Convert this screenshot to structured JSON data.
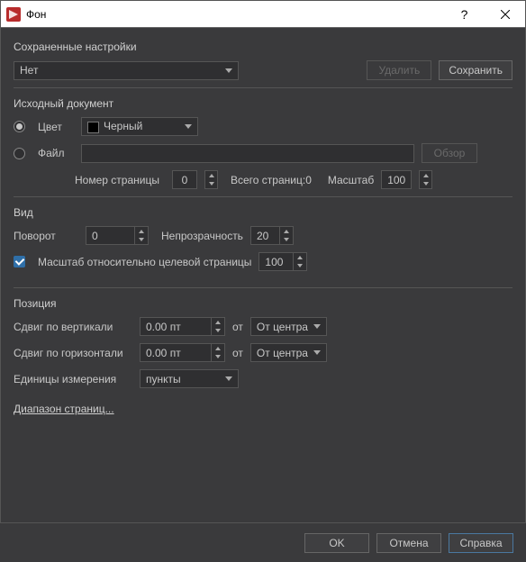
{
  "window": {
    "title": "Фон"
  },
  "saved": {
    "label": "Сохраненные настройки",
    "preset": "Нет",
    "delete": "Удалить",
    "save": "Сохранить"
  },
  "source": {
    "label": "Исходный документ",
    "color_label": "Цвет",
    "color_value": "Черный",
    "file_label": "Файл",
    "file_value": "",
    "browse": "Обзор",
    "page_num_label": "Номер страницы",
    "page_num": "0",
    "total_label": "Всего страниц:",
    "total": "0",
    "scale_label": "Масштаб",
    "scale": "100"
  },
  "view": {
    "label": "Вид",
    "rotate_label": "Поворот",
    "rotate": "0",
    "opacity_label": "Непрозрачность",
    "opacity": "20",
    "scale_check": "Масштаб относительно целевой страницы",
    "scale_val": "100"
  },
  "pos": {
    "label": "Позиция",
    "voff_label": "Сдвиг по вертикали",
    "voff": "0.00 пт",
    "hoff_label": "Сдвиг по горизонтали",
    "hoff": "0.00 пт",
    "from": "от",
    "from_v": "От центра",
    "from_h": "От центра",
    "units_label": "Единицы измерения",
    "units": "пункты"
  },
  "range_link": "Диапазон страниц...",
  "footer": {
    "ok": "OK",
    "cancel": "Отмена",
    "help": "Справка"
  }
}
